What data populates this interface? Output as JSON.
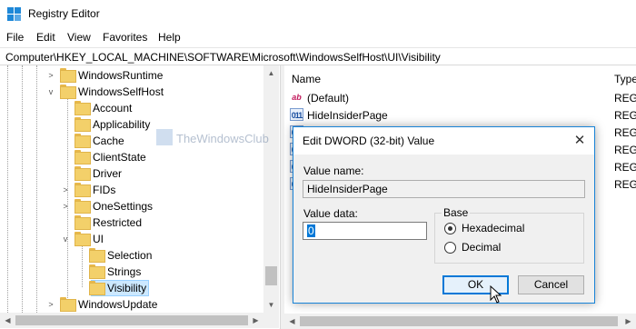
{
  "window": {
    "title": "Registry Editor"
  },
  "menu": [
    "File",
    "Edit",
    "View",
    "Favorites",
    "Help"
  ],
  "address": "Computer\\HKEY_LOCAL_MACHINE\\SOFTWARE\\Microsoft\\WindowsSelfHost\\UI\\Visibility",
  "tree": {
    "items": [
      {
        "label": "WindowsRuntime",
        "expander": ">"
      },
      {
        "label": "WindowsSelfHost",
        "expander": "v"
      },
      {
        "label": "Account",
        "expander": ""
      },
      {
        "label": "Applicability",
        "expander": ""
      },
      {
        "label": "Cache",
        "expander": ""
      },
      {
        "label": "ClientState",
        "expander": ""
      },
      {
        "label": "Driver",
        "expander": ""
      },
      {
        "label": "FIDs",
        "expander": ">"
      },
      {
        "label": "OneSettings",
        "expander": ">"
      },
      {
        "label": "Restricted",
        "expander": ""
      },
      {
        "label": "UI",
        "expander": "v"
      },
      {
        "label": "Selection",
        "expander": ""
      },
      {
        "label": "Strings",
        "expander": ""
      },
      {
        "label": "Visibility",
        "expander": ""
      },
      {
        "label": "WindowsUpdate",
        "expander": ">"
      }
    ]
  },
  "list": {
    "columns": {
      "name": "Name",
      "type": "Type"
    },
    "rows": [
      {
        "name": "(Default)",
        "type": "REG_",
        "icon": "string-value-icon"
      },
      {
        "name": "HideInsiderPage",
        "type": "REG_",
        "icon": "binary-value-icon"
      },
      {
        "name": "",
        "type": "REG_",
        "icon": "binary-value-icon"
      },
      {
        "name": "",
        "type": "REG_",
        "icon": "binary-value-icon"
      },
      {
        "name": "",
        "type": "REG_",
        "icon": "binary-value-icon"
      },
      {
        "name": "",
        "type": "REG_",
        "icon": "binary-value-icon"
      }
    ]
  },
  "dialog": {
    "title": "Edit DWORD (32-bit) Value",
    "value_name_label": "Value name:",
    "value_name": "HideInsiderPage",
    "value_data_label": "Value data:",
    "value_data": "0",
    "base_label": "Base",
    "radios": [
      {
        "label": "Hexadecimal",
        "checked": true
      },
      {
        "label": "Decimal",
        "checked": false
      }
    ],
    "ok_label": "OK",
    "cancel_label": "Cancel",
    "close_glyph": "✕"
  },
  "watermark": "TheWindowsClub",
  "colors": {
    "accent": "#0078d7",
    "selection": "#cce8ff",
    "folder": "#f3d06a"
  }
}
